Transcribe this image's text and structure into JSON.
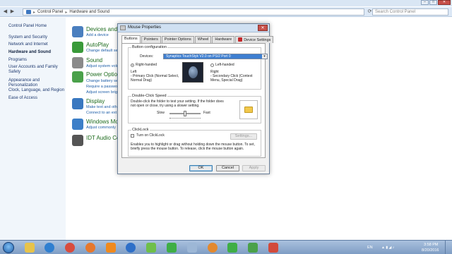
{
  "explorer": {
    "address": [
      "Control Panel",
      "Hardware and Sound"
    ],
    "search_placeholder": "Search Control Panel"
  },
  "leftpane": {
    "home": "Control Panel Home",
    "items": [
      "System and Security",
      "Network and Internet",
      "Hardware and Sound",
      "Programs",
      "User Accounts and Family Safety",
      "Appearance and Personalization",
      "Clock, Language, and Region",
      "Ease of Access"
    ]
  },
  "categories": [
    {
      "title": "Devices and P",
      "subs": [
        "Add a device"
      ],
      "color": "#4a7fbf"
    },
    {
      "title": "AutoPlay",
      "subs": [
        "Change default se"
      ],
      "color": "#3a9a3a"
    },
    {
      "title": "Sound",
      "subs": [
        "Adjust system volu"
      ],
      "color": "#8a8a8a"
    },
    {
      "title": "Power Option",
      "subs": [
        "Change battery se",
        "Require a passwo",
        "Adjust screen brig"
      ],
      "color": "#4aa14a"
    },
    {
      "title": "Display",
      "subs": [
        "Make text and oth",
        "Connect to an ext"
      ],
      "color": "#3a78c0"
    },
    {
      "title": "Windows Mo",
      "subs": [
        "Adjust commonly"
      ],
      "color": "#3d7fc8"
    },
    {
      "title": "IDT Audio Co",
      "subs": [],
      "color": "#555"
    }
  ],
  "dialog": {
    "title": "Mouse Properties",
    "tabs": [
      "Buttons",
      "Pointers",
      "Pointer Options",
      "Wheel",
      "Hardware",
      "Device Settings"
    ],
    "button_config": {
      "label": "Button configuration",
      "devices_label": "Devices:",
      "device_value": "Synaptics TouchStyk V2.0 on PS/2 Port 0",
      "right_handed": "Right-handed",
      "left_handed": "Left-handed",
      "left_title": "Left",
      "left_desc": "- Primary Click (Normal Select, Normal Drag)",
      "right_title": "Right",
      "right_desc": "- Secondary Click (Context Menu, Special Drag)"
    },
    "double_click": {
      "label": "Double-Click Speed",
      "desc": "Double-click the folder to test your setting.  If the folder does not open or close, try using a slower setting.",
      "slow": "Slow",
      "fast": "Fast",
      "speed_fraction": 0.5
    },
    "clicklock": {
      "label": "ClickLock",
      "checkbox": "Turn on ClickLock",
      "settings_btn": "Settings...",
      "desc": "Enables you to highlight or drag without holding down the mouse button.  To set, briefly press the mouse button.  To release, click the mouse button again."
    },
    "buttons": {
      "ok": "OK",
      "cancel": "Cancel",
      "apply": "Apply"
    }
  },
  "taskbar": {
    "lang": "EN",
    "time": "3:58 PM",
    "date": "8/20/2016"
  }
}
